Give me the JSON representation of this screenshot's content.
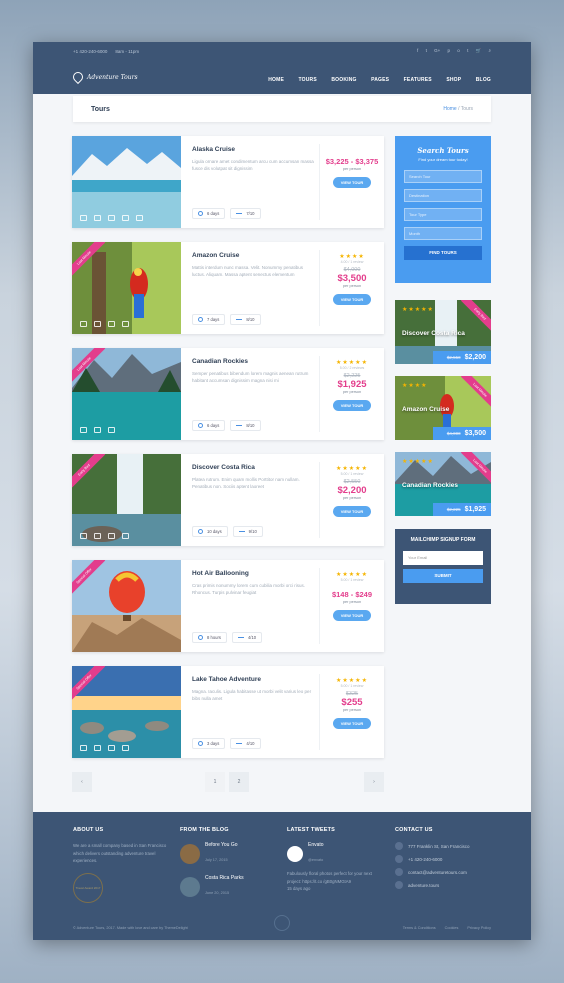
{
  "topbar": {
    "phone": "+1 420-240-6000",
    "hours": "8am - 11pm",
    "social": [
      "f",
      "t",
      "G+",
      "p",
      "o",
      "t"
    ]
  },
  "header": {
    "logo": "Adventure Tours",
    "nav": [
      "HOME",
      "TOURS",
      "BOOKING",
      "PAGES",
      "FEATURES",
      "SHOP",
      "BLOG"
    ]
  },
  "breadcrumb": {
    "title": "Tours",
    "home": "Home",
    "sep": " / ",
    "current": "Tours"
  },
  "tours": [
    {
      "title": "Alaska Cruise",
      "desc": "Ligula ornare amet condimentum arcu cum accumsan massa fusce dis volutpat sit dignissim",
      "days": "6 days",
      "rating": "7/10",
      "stars": "",
      "reviews": "",
      "old": "",
      "price": "$3,225 - $3,375",
      "per": "per person",
      "btn": "VIEW TOUR",
      "ribbon": ""
    },
    {
      "title": "Amazon Cruise",
      "desc": "Mattis interdum nunc massa. Velit. Nonummy penatibus luctus. Aliquam. Massa aptent senectus elementum",
      "days": "7 days",
      "rating": "8/10",
      "stars": "★★★★",
      "reviews": "4.00 / 1 review",
      "old": "$4,000",
      "price": "$3,500",
      "per": "per person",
      "btn": "VIEW TOUR",
      "ribbon": "Last Minute"
    },
    {
      "title": "Canadian Rockies",
      "desc": "Semper penatibus bibendum lorem magnis aenean rutrum habitant accumsan dignissim magna nisi mi",
      "days": "6 days",
      "rating": "8/10",
      "stars": "★★★★★",
      "reviews": "5.00 / 2 reviews",
      "old": "$2,225",
      "price": "$1,925",
      "per": "per person",
      "btn": "VIEW TOUR",
      "ribbon": "Last Minute"
    },
    {
      "title": "Discover Costa Rica",
      "desc": "Platea rutrum. Enim quam mollis Porttitor nam nullam. Penatibus non. Sociis aptent laoreet",
      "days": "10 days",
      "rating": "9/10",
      "stars": "★★★★★",
      "reviews": "5.00 / 1 review",
      "old": "$2,550",
      "price": "$2,200",
      "per": "per person",
      "btn": "VIEW TOUR",
      "ribbon": "Early Bird"
    },
    {
      "title": "Hot Air Ballooning",
      "desc": "Cras primis nonummy lorem cum cubilia morbi orci risus. Rhoncus. Turpis pulvinar feugiat",
      "days": "8 hours",
      "rating": "4/10",
      "stars": "★★★★★",
      "reviews": "5.00 / 1 review",
      "old": "",
      "price": "$148 - $249",
      "per": "per person",
      "btn": "VIEW TOUR",
      "ribbon": "Special Offer"
    },
    {
      "title": "Lake Tahoe Adventure",
      "desc": "Magna. Iaculis. Ligula habitasse ut morbi velit varius leo per bibs nulla amet",
      "days": "3 days",
      "rating": "4/10",
      "stars": "★★★★★",
      "reviews": "5.00 / 1 review",
      "old": "$325",
      "price": "$255",
      "per": "per person",
      "btn": "VIEW TOUR",
      "ribbon": "Special Offer"
    }
  ],
  "pagination": {
    "prev": "‹",
    "pages": [
      "1",
      "2"
    ],
    "next": "›"
  },
  "search": {
    "title": "Search Tours",
    "sub": "Find your dream tour today!",
    "fields": [
      "Search Tour",
      "Destination",
      "Tour Type",
      "Month"
    ],
    "button": "FIND TOURS"
  },
  "promos": [
    {
      "title": "Discover Costa Rica",
      "old": "$2,550",
      "price": "$2,200",
      "stars": "★★★★★",
      "ribbon": "Early Bird"
    },
    {
      "title": "Amazon Cruise",
      "old": "$4,000",
      "price": "$3,500",
      "stars": "★★★★",
      "ribbon": "Last Minute"
    },
    {
      "title": "Canadian Rockies",
      "old": "$2,225",
      "price": "$1,925",
      "stars": "★★★★★",
      "ribbon": "Last Minute"
    }
  ],
  "mailchimp": {
    "title": "MAILCHIMP SIGNUP FORM",
    "placeholder": "Your Email",
    "button": "SUBMIT"
  },
  "footer": {
    "about_title": "ABOUT US",
    "about_text": "We are a small company based in San Francisco which delivers outstanding adventure travel experiences.",
    "badge": "Travel Award 2017",
    "blog_title": "FROM THE BLOG",
    "posts": [
      {
        "title": "Before You Go",
        "date": "July 17, 2015"
      },
      {
        "title": "Costa Rica Parks",
        "date": "June 20, 2015"
      }
    ],
    "tweets_title": "LATEST TWEETS",
    "tweet_user": "Envato",
    "tweet_handle": "@envato",
    "tweet_text": "Fabulously floral photos perfect for your next project: https://t.co /gB0gNMGtA9",
    "tweet_time": "15 days ago",
    "contact_title": "CONTACT US",
    "contact": [
      "777 Franklin St, San Francisco",
      "+1 420-240-6000",
      "contact@adventuretours.com",
      "adventure.tours"
    ],
    "copyright": "© Adventure Tours, 2017. Made with love and care by ThemeDelight",
    "links": [
      "Terms & Conditions",
      "Cookies",
      "Privacy Policy"
    ]
  },
  "colors": {
    "header": "#3d5575",
    "accent": "#4a9cf0",
    "price": "#e33d8c",
    "star": "#f5b400"
  }
}
